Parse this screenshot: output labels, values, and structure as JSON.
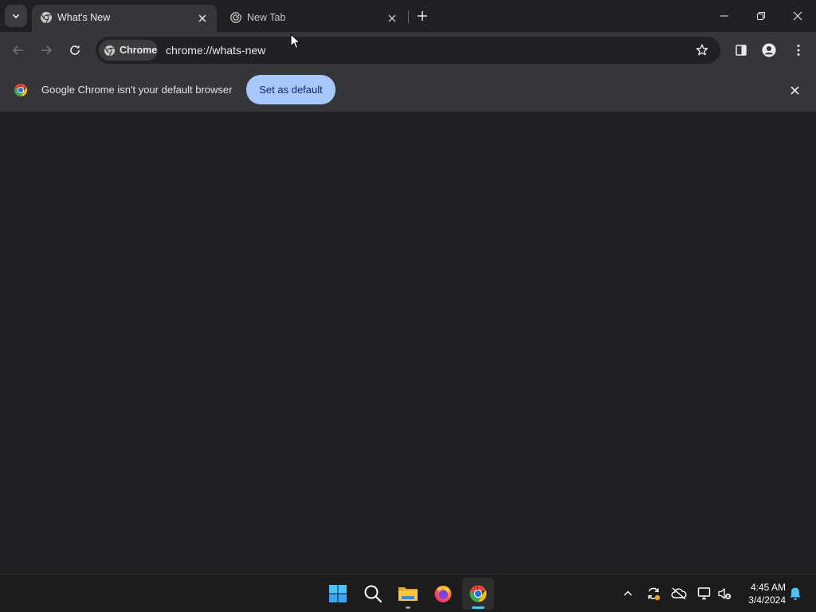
{
  "tabs": [
    {
      "title": "What's New",
      "active": true,
      "icon": "chrome-icon"
    },
    {
      "title": "New Tab",
      "active": false,
      "icon": "new-tab-icon"
    }
  ],
  "omnibox": {
    "chip_label": "Chrome",
    "url": "chrome://whats-new"
  },
  "infobar": {
    "message": "Google Chrome isn't your default browser",
    "button_label": "Set as default"
  },
  "taskbar": {
    "apps": [
      "start-icon",
      "search-icon",
      "file-explorer-icon",
      "firefox-icon",
      "chrome-icon"
    ],
    "tray_icons": [
      "chevron-up-icon",
      "sync-icon",
      "onedrive-icon",
      "network-icon",
      "volume-muted-icon",
      "notification-bell-icon"
    ],
    "time": "4:45 AM",
    "date": "3/4/2024"
  },
  "colors": {
    "accent_button": "#a8c7fa",
    "toolbar": "#35363a",
    "content_bg": "#1f2024",
    "taskbar": "#1c1c1c"
  }
}
